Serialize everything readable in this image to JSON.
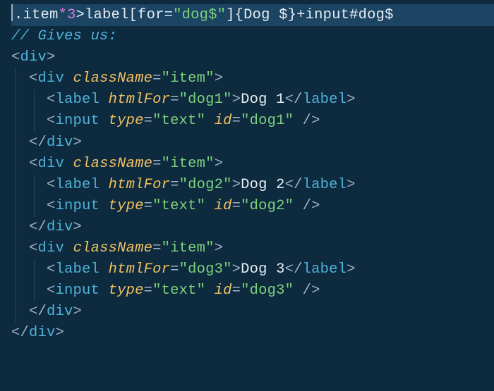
{
  "line1": {
    "emmet_a": ".item",
    "star": "*",
    "count": "3",
    "emmet_b": ">label[for=",
    "str1": "\"dog$\"",
    "emmet_c": "]{Dog $}+input#dog$"
  },
  "comment": "// Gives us:",
  "tags": {
    "div_open": "div",
    "div_close": "div",
    "label_open": "label",
    "label_close": "label",
    "input": "input"
  },
  "attrs": {
    "className": "className",
    "htmlFor": "htmlFor",
    "type": "type",
    "id": "id"
  },
  "vals": {
    "item": "\"item\"",
    "dog1": "\"dog1\"",
    "dog2": "\"dog2\"",
    "dog3": "\"dog3\"",
    "text": "\"text\""
  },
  "text": {
    "dog1": "Dog 1",
    "dog2": "Dog 2",
    "dog3": "Dog 3"
  },
  "punct": {
    "lt": "<",
    "gt": ">",
    "lts": "</",
    "sc": " />",
    "eq": "="
  }
}
